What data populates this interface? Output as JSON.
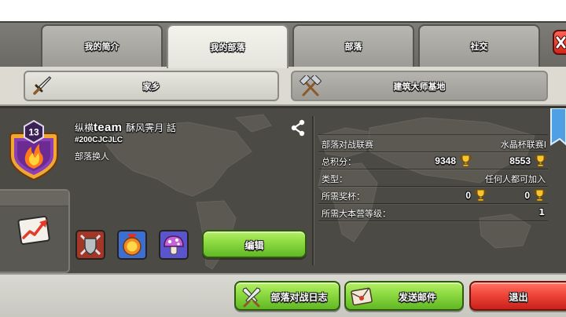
{
  "tabs": [
    {
      "label": "我的简介",
      "active": false
    },
    {
      "label": "我的部落",
      "active": true
    },
    {
      "label": "部落",
      "active": false
    },
    {
      "label": "社交",
      "active": false
    }
  ],
  "close_button": {
    "icon": "close-icon"
  },
  "subtabs": [
    {
      "label": "家乡",
      "icon": "sword-icon"
    },
    {
      "label": "建筑大师基地",
      "icon": "crossed-hammers-icon"
    }
  ],
  "clan": {
    "badge_icon": "clan-badge-icon",
    "level": "13",
    "name_parts": [
      "纵横",
      "team",
      "酥风霁月 話"
    ],
    "tag": "#200CJCJLC",
    "description": "部落换人",
    "share_icon": "share-icon",
    "bookmark_icon": "bookmark-ribbon-icon",
    "stats_icon": "graph-card-icon",
    "labels": [
      {
        "icon": "crossed-swords-shield-icon"
      },
      {
        "icon": "medal-icon"
      },
      {
        "icon": "mushroom-icon"
      }
    ],
    "edit_label": "编辑"
  },
  "info": {
    "war_league": {
      "label": "部落对战联赛",
      "value": "水晶杯联赛I"
    },
    "total_points": {
      "label": "总积分：",
      "home": "9348",
      "builder": "8553",
      "icon": "trophy-icon"
    },
    "type": {
      "label": "类型：",
      "value": "任何人都可加入"
    },
    "required_trophies": {
      "label": "所需奖杯：",
      "home": "0",
      "builder": "0",
      "icon": "trophy-icon"
    },
    "required_town_hall": {
      "label": "所需大本营等级：",
      "value": "1"
    }
  },
  "bottom_buttons": [
    {
      "label": "部落对战日志",
      "icon": "crossed-swords-icon"
    },
    {
      "label": "发送邮件",
      "icon": "envelope-icon"
    },
    {
      "label": "退出"
    }
  ],
  "colors": {
    "tab_active": "#ecebe3",
    "tab_inactive": "#a9a8a2",
    "button_green": "#84d43c",
    "button_red": "#e4372a",
    "ribbon_blue": "#4e9fe3",
    "badge_purple": "#8b3fb5",
    "trophy_gold": "#f6c530",
    "panel_dark": "#4c4a44"
  }
}
